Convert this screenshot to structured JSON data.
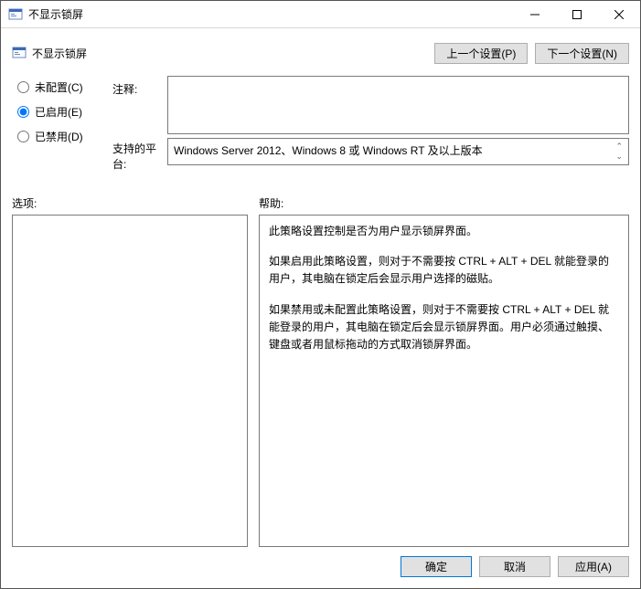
{
  "window": {
    "title": "不显示锁屏"
  },
  "heading": "不显示锁屏",
  "nav": {
    "prev": "上一个设置(P)",
    "next": "下一个设置(N)"
  },
  "radios": {
    "not_configured": "未配置(C)",
    "enabled": "已启用(E)",
    "disabled": "已禁用(D)",
    "selected": "enabled"
  },
  "labels": {
    "comment": "注释:",
    "supported": "支持的平台:",
    "options": "选项:",
    "help": "帮助:"
  },
  "comment": "",
  "supported": "Windows Server 2012、Windows 8 或 Windows RT 及以上版本",
  "help": {
    "p1": "此策略设置控制是否为用户显示锁屏界面。",
    "p2": "如果启用此策略设置，则对于不需要按 CTRL + ALT + DEL  就能登录的用户，其电脑在锁定后会显示用户选择的磁贴。",
    "p3": "如果禁用或未配置此策略设置，则对于不需要按 CTRL + ALT + DEL 就能登录的用户，其电脑在锁定后会显示锁屏界面。用户必须通过触摸、键盘或者用鼠标拖动的方式取消锁屏界面。"
  },
  "footer": {
    "ok": "确定",
    "cancel": "取消",
    "apply": "应用(A)"
  }
}
